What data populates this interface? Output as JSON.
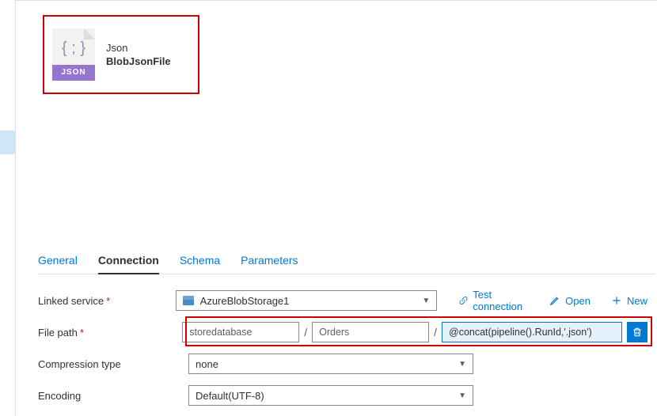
{
  "dataset": {
    "type_label": "Json",
    "name": "BlobJsonFile",
    "icon_band_text": "JSON",
    "icon_braces": "{ ; }"
  },
  "tabs": {
    "general": "General",
    "connection": "Connection",
    "schema": "Schema",
    "parameters": "Parameters"
  },
  "form": {
    "linked_service_label": "Linked service",
    "file_path_label": "File path",
    "compression_label": "Compression type",
    "encoding_label": "Encoding",
    "required_mark": "*"
  },
  "linked_service": {
    "value": "AzureBlobStorage1",
    "test_connection": "Test connection",
    "open": "Open",
    "new": "New"
  },
  "file_path": {
    "container": "storedatabase",
    "directory": "Orders",
    "file_expression": "@concat(pipeline().RunId,'.json')",
    "separator": "/"
  },
  "compression": {
    "value": "none"
  },
  "encoding": {
    "value": "Default(UTF-8)"
  }
}
